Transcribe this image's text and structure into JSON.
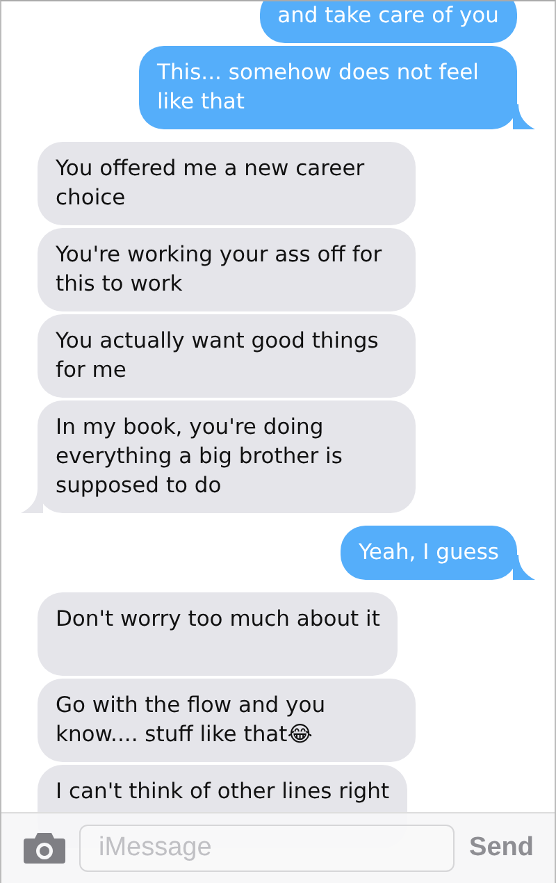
{
  "messages": [
    {
      "kind": "sent",
      "text": "and take care of you",
      "tail": false
    },
    {
      "kind": "sent",
      "text": "This... somehow does not feel like that",
      "tail": true
    },
    {
      "kind": "received",
      "text": "You offered me a new career choice",
      "tail": false
    },
    {
      "kind": "received",
      "text": "You're working your ass off for this to work",
      "tail": false
    },
    {
      "kind": "received",
      "text": "You actually want good things for me",
      "tail": false
    },
    {
      "kind": "received",
      "text": "In my book, you're doing everything a big brother is supposed to do",
      "tail": true
    },
    {
      "kind": "sent",
      "text": "Yeah, I guess",
      "tail": true
    },
    {
      "kind": "received",
      "text": "Don't worry too much about it",
      "tail": false
    },
    {
      "kind": "received",
      "text": "Go with the flow and you know.... stuff like that😂",
      "tail": false
    },
    {
      "kind": "received",
      "text": "I can't think of other lines right"
    }
  ],
  "compose": {
    "placeholder": "iMessage",
    "send": "Send"
  }
}
